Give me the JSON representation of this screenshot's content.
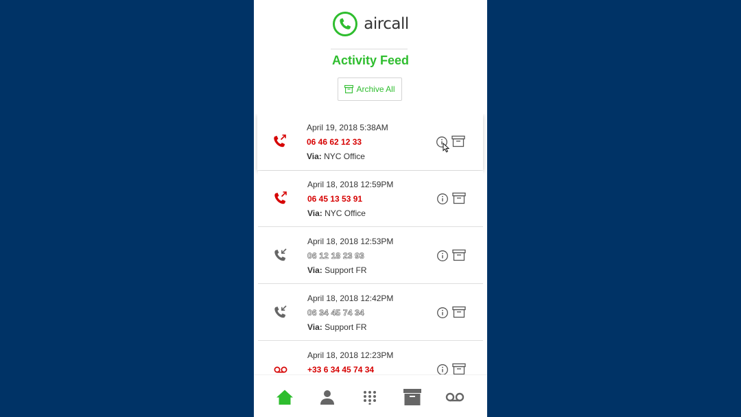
{
  "brand": {
    "name": "aircall",
    "color": "#2ebd2e"
  },
  "page": {
    "title": "Activity Feed"
  },
  "toolbar": {
    "archive_all_label": "Archive All"
  },
  "colors": {
    "missed": "#d60000",
    "accent": "#2ebd2e",
    "icon": "#666666",
    "background": "#003366"
  },
  "feed": {
    "items": [
      {
        "type": "outgoing-missed-call",
        "icon": "phone-outgoing-icon",
        "date": "April 19, 2018 5:38AM",
        "number": "06 46 62 12 33",
        "via_label": "Via:",
        "via_value": "NYC Office"
      },
      {
        "type": "outgoing-missed-call",
        "icon": "phone-outgoing-icon",
        "date": "April 18, 2018 12:59PM",
        "number": "06 45 13 53 91",
        "via_label": "Via:",
        "via_value": "NYC Office"
      },
      {
        "type": "incoming-call",
        "icon": "phone-incoming-icon",
        "date": "April 18, 2018 12:53PM",
        "number": "06 12 18 23 93",
        "via_label": "Via:",
        "via_value": "Support FR"
      },
      {
        "type": "incoming-call",
        "icon": "phone-incoming-icon",
        "date": "April 18, 2018 12:42PM",
        "number": "06 34 45 74 34",
        "via_label": "Via:",
        "via_value": "Support FR"
      },
      {
        "type": "voicemail",
        "icon": "voicemail-icon",
        "date": "April 18, 2018 12:23PM",
        "number": "+33 6 34 45 74 34",
        "via_label": "",
        "via_value": ""
      }
    ]
  },
  "bottom_nav": {
    "items": [
      {
        "icon": "home-icon",
        "active": true
      },
      {
        "icon": "contacts-icon",
        "active": false
      },
      {
        "icon": "keypad-icon",
        "active": false
      },
      {
        "icon": "archive-icon",
        "active": false
      },
      {
        "icon": "voicemail-icon",
        "active": false
      }
    ]
  }
}
